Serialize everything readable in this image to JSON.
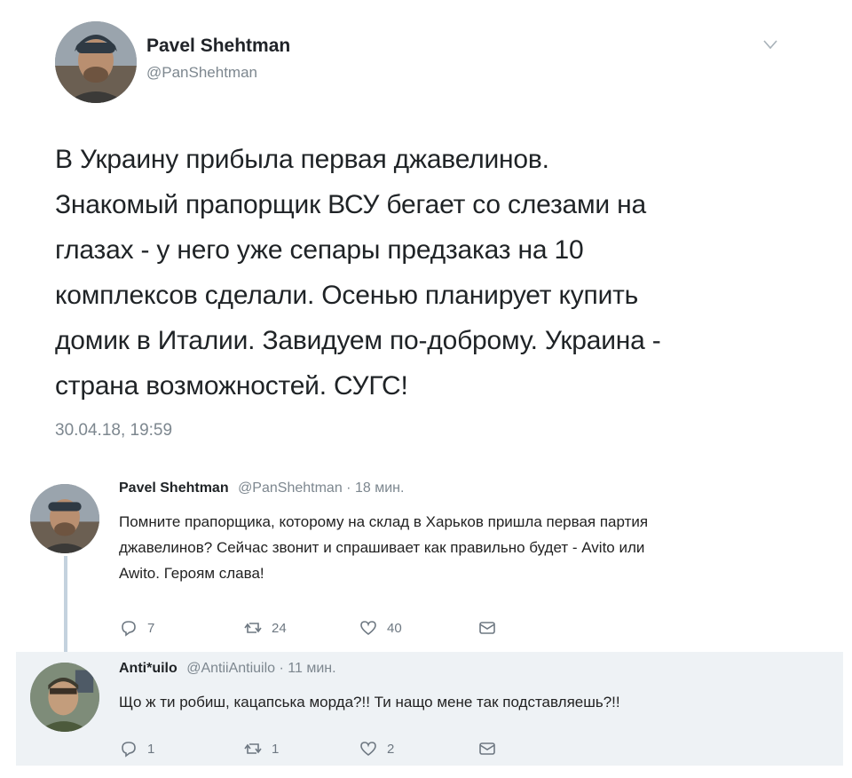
{
  "main_tweet": {
    "display_name": "Pavel Shehtman",
    "handle": "@PanShehtman",
    "text_lines": [
      "В Украину прибыла первая джавелинов.",
      "Знакомый прапорщик ВСУ бегает со слезами на",
      "глазах - у него уже сепары предзаказ на 10",
      "комплексов сделали. Осенью планирует купить",
      "домик в Италии. Завидуем по-доброму. Украина -",
      "страна возможностей. СУГС!"
    ],
    "timestamp": "30.04.18, 19:59",
    "menu_icon": "chevron-down-icon"
  },
  "replies": [
    {
      "display_name": "Pavel Shehtman",
      "handle": "@PanShehtman",
      "separator": "·",
      "time": "18 мин.",
      "text_lines": [
        "Помните прапорщика, которому на склад в Харьков пришла первая партия",
        "джавелинов? Сейчас звонит и спрашивает как правильно будет - Avito или",
        "Awito. Героям слава!"
      ],
      "reply_count": "7",
      "retweet_count": "24",
      "like_count": "40"
    },
    {
      "display_name": "Anti*uilo",
      "handle": "@AntiiAntiuilo",
      "separator": "·",
      "time": "11 мин.",
      "text_lines": [
        "Що ж ти робиш, кацапська морда?!! Ти нащо мене так подставляешь?!!"
      ],
      "reply_count": "1",
      "retweet_count": "1",
      "like_count": "2"
    }
  ],
  "colors": {
    "text": "#1f2326",
    "muted": "#7d878f",
    "thread_line": "#c4d2de",
    "highlight_bg": "#eef2f5"
  }
}
